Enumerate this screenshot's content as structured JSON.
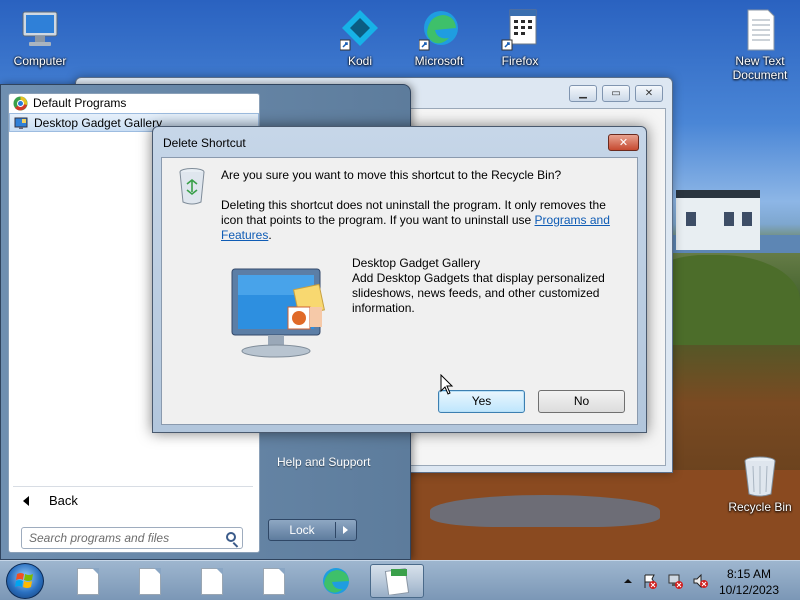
{
  "desktop": {
    "icons": [
      {
        "label": "Computer",
        "icon": "computer-icon"
      },
      {
        "label": "Kodi",
        "icon": "kodi-icon"
      },
      {
        "label": "Microsoft",
        "icon": "edge-icon"
      },
      {
        "label": "Firefox",
        "icon": "firefox-icon"
      },
      {
        "label": "New Text Document",
        "icon": "text-document-icon"
      },
      {
        "label": "Recycle Bin",
        "icon": "recycle-bin-icon"
      }
    ]
  },
  "start_menu": {
    "programs": [
      {
        "label": "Default Programs",
        "icon": "default-programs-icon"
      },
      {
        "label": "Desktop Gadget Gallery",
        "icon": "gadget-gallery-icon"
      }
    ],
    "back_label": "Back",
    "search_placeholder": "Search programs and files",
    "help_label": "Help and Support",
    "lock_label": "Lock"
  },
  "dialog": {
    "title": "Delete Shortcut",
    "close_label": "✕",
    "question": "Are you sure you want to move this shortcut to the Recycle Bin?",
    "detail_line1": "Deleting this shortcut does not uninstall the program. It only removes the",
    "detail_line2": "icon that points to the program. If you want to uninstall use ",
    "link_part1": "Programs and",
    "link_part2": "Features",
    "detail_end": ".",
    "item_name": "Desktop Gadget Gallery",
    "item_desc1": "Add Desktop Gadgets that display personalized",
    "item_desc2": "slideshows, news feeds, and other customized",
    "item_desc3": "information.",
    "yes_label": "Yes",
    "no_label": "No"
  },
  "taskbar": {
    "time": "8:15 AM",
    "date": "10/12/2023"
  }
}
